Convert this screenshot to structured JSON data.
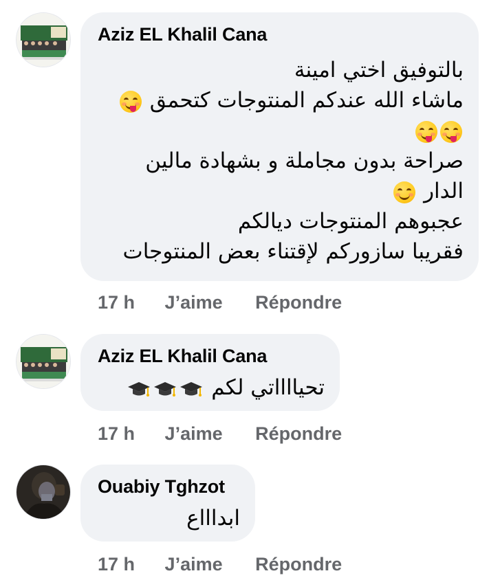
{
  "comments": [
    {
      "author": "Aziz EL Khalil Cana",
      "lines": [
        "بالتوفيق اختي امينة",
        "ماشاء الله عندكم المنتوجات كتحمق",
        "",
        "صراحة بدون مجاملة و بشهادة مالين",
        "الدار",
        "عجبوهم المنتوجات ديالكم",
        "فقريبا سازوركم لإقتناء بعض المنتوجات"
      ],
      "time": "17 h",
      "like_label": "J’aime",
      "reply_label": "Répondre"
    },
    {
      "author": "Aziz EL Khalil Cana",
      "lines": [
        "تحيااااتي لكم"
      ],
      "time": "17 h",
      "like_label": "J’aime",
      "reply_label": "Répondre"
    },
    {
      "author": "Ouabiy Tghzot",
      "lines": [
        "ابداااع"
      ],
      "time": "17 h",
      "like_label": "J’aime",
      "reply_label": "Répondre"
    }
  ],
  "icons": {
    "emoji": "face-savoring-food-emoji",
    "emoji_smile": "smiling-face-emoji",
    "grad_cap": "graduation-cap-emoji"
  },
  "colors": {
    "bubble": "#f0f2f5",
    "action_text": "#65676b",
    "text": "#050505"
  }
}
